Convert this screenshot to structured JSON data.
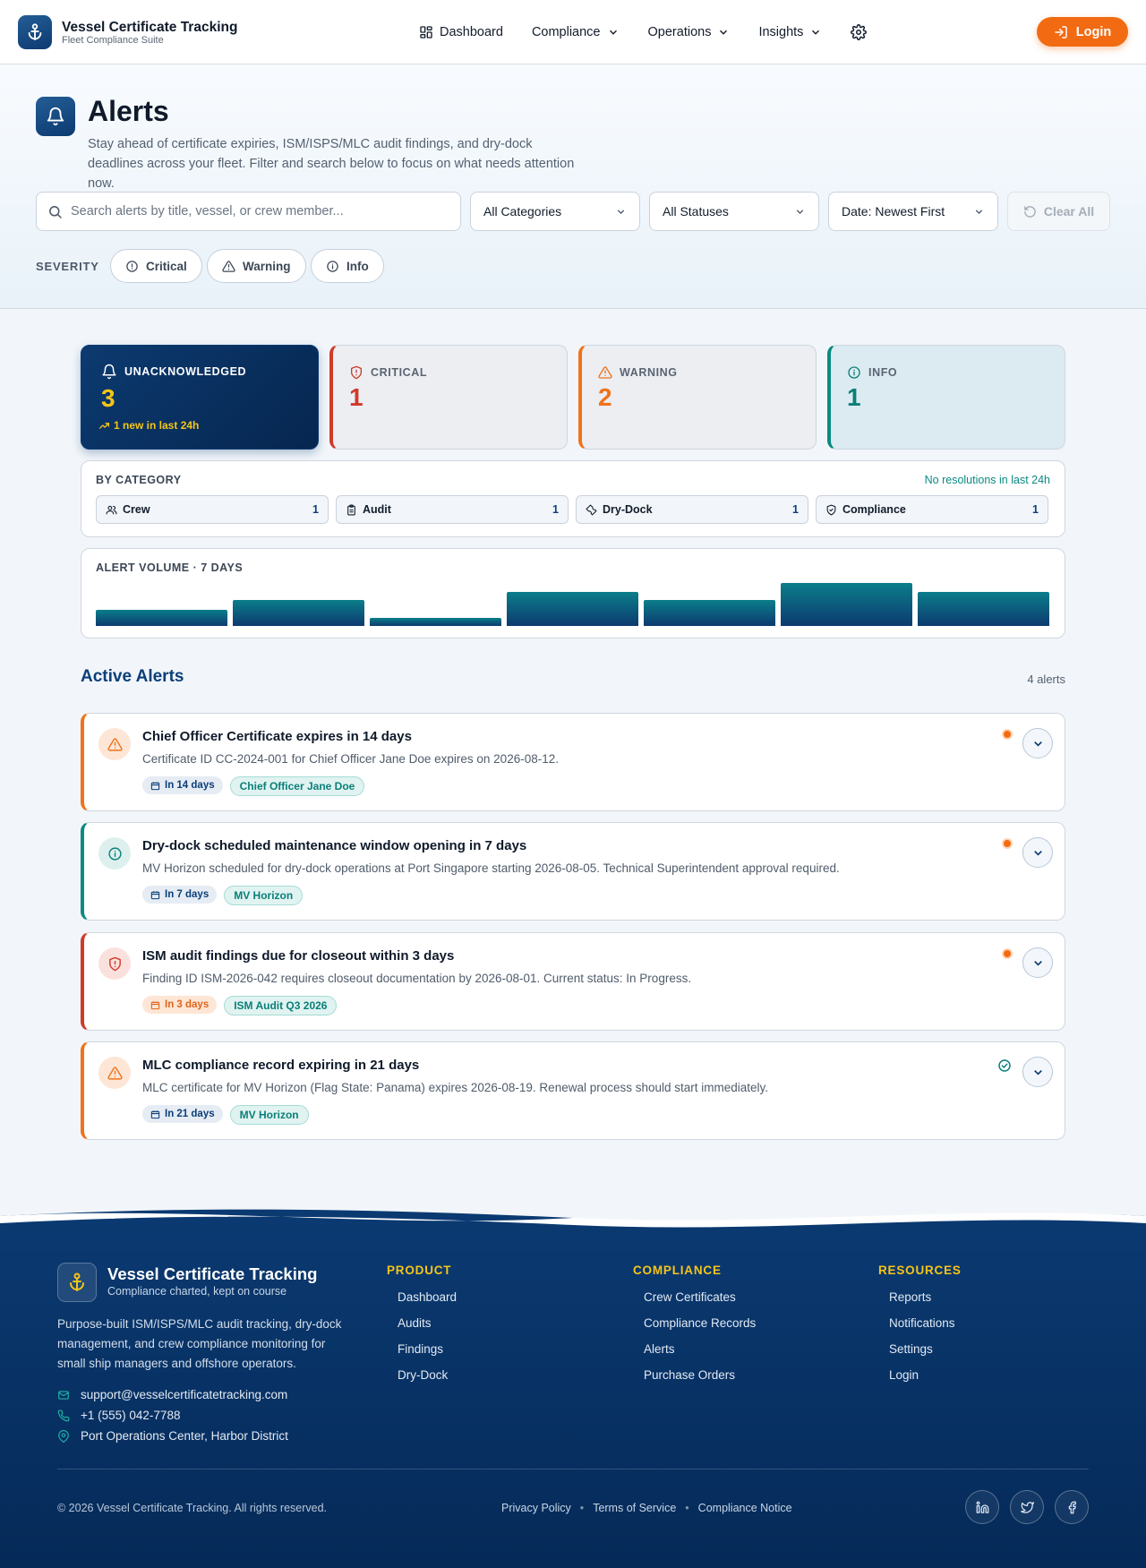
{
  "header": {
    "brand_title": "Vessel Certificate Tracking",
    "brand_subtitle": "Fleet Compliance Suite",
    "nav": [
      {
        "label": "Dashboard",
        "icon": "grid-icon",
        "has_dropdown": false
      },
      {
        "label": "Compliance",
        "icon": "",
        "has_dropdown": true
      },
      {
        "label": "Operations",
        "icon": "",
        "has_dropdown": true
      },
      {
        "label": "Insights",
        "icon": "",
        "has_dropdown": true
      }
    ],
    "settings_icon": "gear-icon",
    "login_label": "Login"
  },
  "hero": {
    "title": "Alerts",
    "description": "Stay ahead of certificate expiries, ISM/ISPS/MLC audit findings, and dry-dock deadlines across your fleet. Filter and search below to focus on what needs attention now.",
    "search_placeholder": "Search alerts by title, vessel, or crew member...",
    "filters": {
      "category": "All Categories",
      "status": "All Statuses",
      "sort": "Date: Newest First"
    },
    "clear_label": "Clear All",
    "severity_label": "SEVERITY",
    "severity_chips": [
      "Critical",
      "Warning",
      "Info"
    ]
  },
  "stats": {
    "unacknowledged": {
      "label": "UNACKNOWLEDGED",
      "value": "3",
      "trend": "1 new in last 24h"
    },
    "critical": {
      "label": "CRITICAL",
      "value": "1"
    },
    "warning": {
      "label": "WARNING",
      "value": "2"
    },
    "info": {
      "label": "INFO",
      "value": "1"
    }
  },
  "categories": {
    "heading": "BY CATEGORY",
    "note": "No resolutions in last 24h",
    "items": [
      {
        "label": "Crew",
        "count": "1",
        "icon": "users-icon"
      },
      {
        "label": "Audit",
        "count": "1",
        "icon": "clipboard-icon"
      },
      {
        "label": "Dry-Dock",
        "count": "1",
        "icon": "wrench-icon"
      },
      {
        "label": "Compliance",
        "count": "1",
        "icon": "shield-check-icon"
      }
    ]
  },
  "volume": {
    "heading": "ALERT VOLUME · 7 DAYS",
    "relative_levels": [
      0.38,
      0.6,
      0.18,
      0.8,
      0.6,
      1.0,
      0.8
    ]
  },
  "alerts_section": {
    "title": "Active Alerts",
    "count_label": "4 alerts",
    "items": [
      {
        "severity": "warning",
        "title": "Chief Officer Certificate expires in 14 days",
        "description": "Certificate ID CC-2024-001 for Chief Officer Jane Doe expires on 2026-08-12.",
        "due": "In 14 days",
        "entity": "Chief Officer Jane Doe",
        "unread": true
      },
      {
        "severity": "info",
        "title": "Dry-dock scheduled maintenance window opening in 7 days",
        "description": "MV Horizon scheduled for dry-dock operations at Port Singapore starting 2026-08-05. Technical Superintendent approval required.",
        "due": "In 7 days",
        "entity": "MV Horizon",
        "unread": true
      },
      {
        "severity": "critical",
        "title": "ISM audit findings due for closeout within 3 days",
        "description": "Finding ID ISM-2026-042 requires closeout documentation by 2026-08-01. Current status: In Progress.",
        "due": "In 3 days",
        "entity": "ISM Audit Q3 2026",
        "unread": true
      },
      {
        "severity": "warning",
        "title": "MLC compliance record expiring in 21 days",
        "description": "MLC certificate for MV Horizon (Flag State: Panama) expires 2026-08-19. Renewal process should start immediately.",
        "due": "In 21 days",
        "entity": "MV Horizon",
        "unread": false
      }
    ]
  },
  "footer": {
    "brand_title": "Vessel Certificate Tracking",
    "tagline": "Compliance charted, kept on course",
    "description": "Purpose-built ISM/ISPS/MLC audit tracking, dry-dock management, and crew compliance monitoring for small ship managers and offshore operators.",
    "email": "support@vesselcertificatetracking.com",
    "phone": "+1 (555) 042-7788",
    "address": "Port Operations Center, Harbor District",
    "columns": [
      {
        "heading": "PRODUCT",
        "links": [
          "Dashboard",
          "Audits",
          "Findings",
          "Dry-Dock"
        ]
      },
      {
        "heading": "COMPLIANCE",
        "links": [
          "Crew Certificates",
          "Compliance Records",
          "Alerts",
          "Purchase Orders"
        ]
      },
      {
        "heading": "RESOURCES",
        "links": [
          "Reports",
          "Notifications",
          "Settings",
          "Login"
        ]
      }
    ],
    "copyright": "© 2026 Vessel Certificate Tracking. All rights reserved.",
    "legal": [
      "Privacy Policy",
      "Terms of Service",
      "Compliance Notice"
    ],
    "social": [
      "linkedin-icon",
      "twitter-icon",
      "facebook-icon"
    ]
  },
  "colors": {
    "primary": "#0c3a70",
    "accent": "#f26b12",
    "teal": "#0a8a82",
    "critical": "#d03a2a",
    "warning": "#f07219",
    "info": "#0a7f78",
    "highlight": "#f5c518"
  }
}
